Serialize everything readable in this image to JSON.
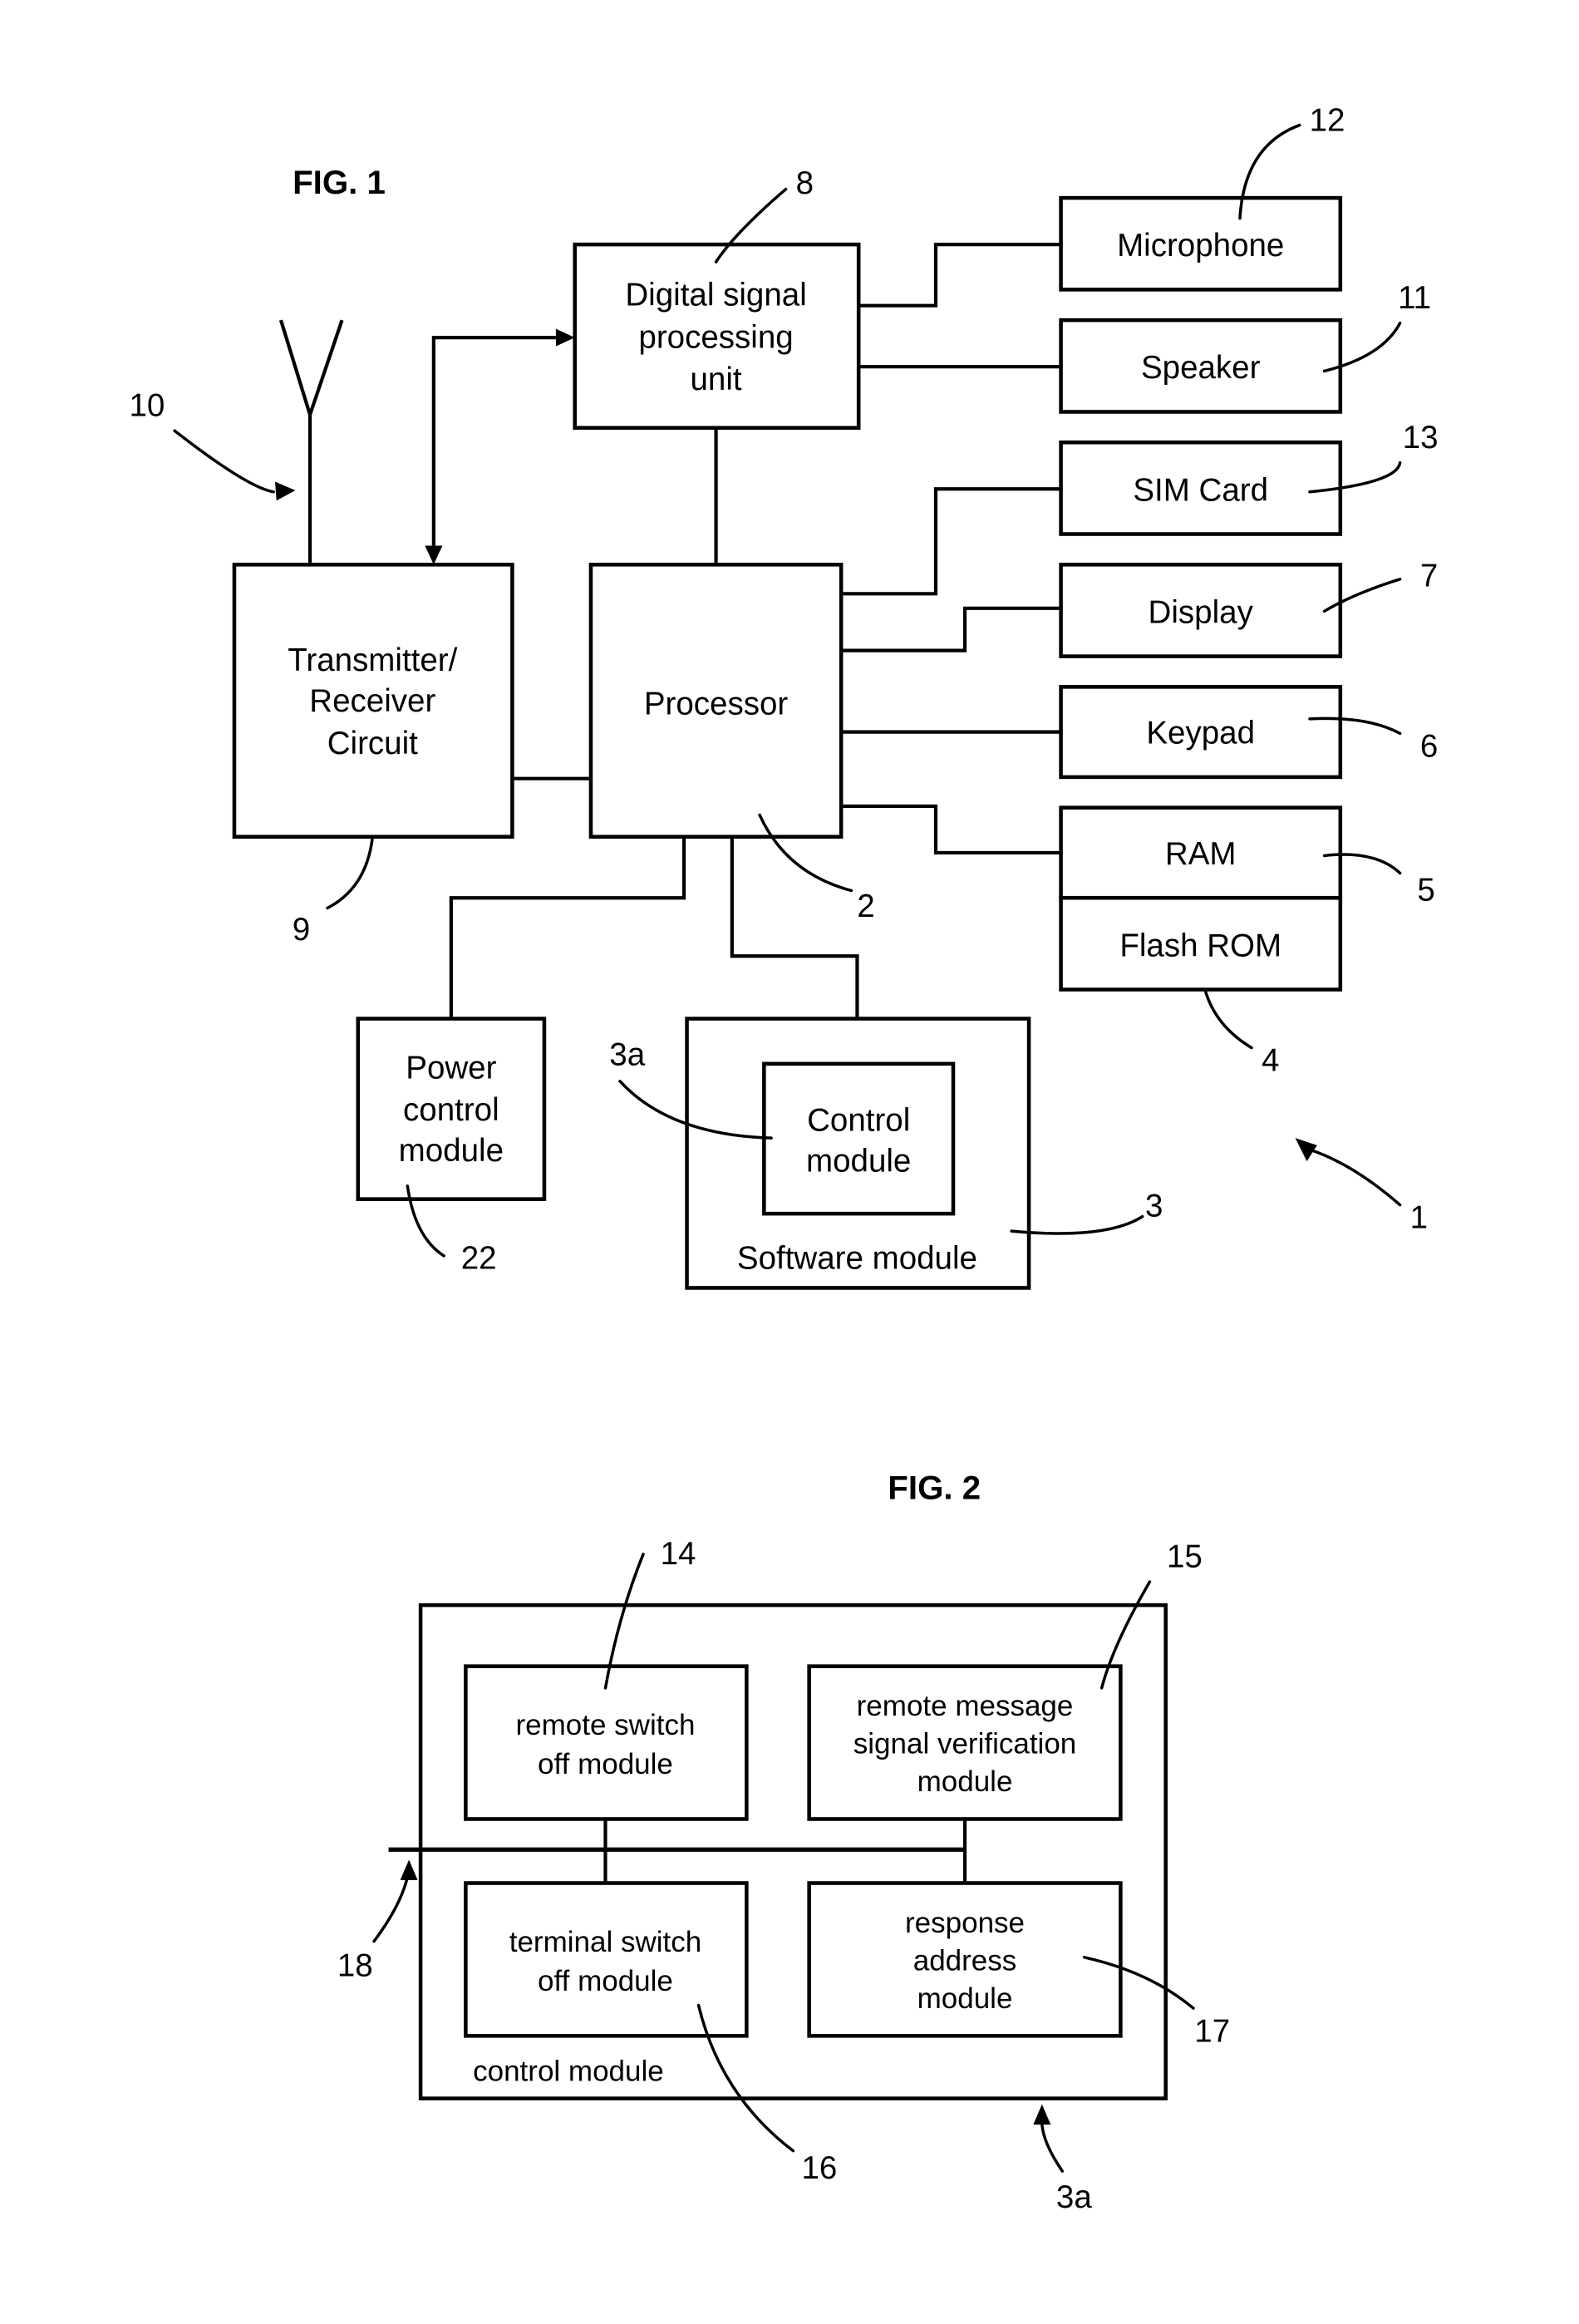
{
  "figure1": {
    "title": "FIG. 1",
    "blocks": {
      "dsp": [
        "Digital signal",
        "processing",
        "unit"
      ],
      "microphone": "Microphone",
      "speaker": "Speaker",
      "sim_card": "SIM Card",
      "display": "Display",
      "keypad": "Keypad",
      "ram": "RAM",
      "flash_rom": "Flash ROM",
      "transceiver": [
        "Transmitter/",
        "Receiver",
        "Circuit"
      ],
      "processor": "Processor",
      "power_control": [
        "Power",
        "control",
        "module"
      ],
      "software_module": "Software module",
      "control_module": [
        "Control",
        "module"
      ]
    },
    "reference_numerals": {
      "device": "1",
      "processor": "2",
      "software_module": "3",
      "control_module": "3a",
      "flash_rom": "4",
      "ram": "5",
      "keypad": "6",
      "display": "7",
      "dsp": "8",
      "transceiver": "9",
      "antenna": "10",
      "speaker": "11",
      "microphone": "12",
      "sim_card": "13",
      "power_control": "22"
    }
  },
  "figure2": {
    "title": "FIG. 2",
    "container_label": "control module",
    "blocks": {
      "remote_switch_off": [
        "remote switch",
        "off module"
      ],
      "remote_message_verification": [
        "remote message",
        "signal verification",
        "module"
      ],
      "terminal_switch_off": [
        "terminal switch",
        "off module"
      ],
      "response_address": [
        "response",
        "address",
        "module"
      ]
    },
    "reference_numerals": {
      "control_module": "3a",
      "remote_switch_off": "14",
      "remote_message_verification": "15",
      "terminal_switch_off": "16",
      "response_address": "17",
      "bus": "18"
    }
  }
}
